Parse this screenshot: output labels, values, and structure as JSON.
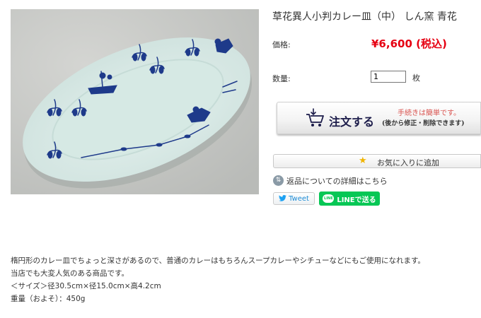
{
  "product": {
    "title": "草花異人小判カレー皿（中） しん窯 青花",
    "price_label": "価格:",
    "price_value": "¥6,600 (税込)",
    "quantity_label": "数量:",
    "quantity_value": "1",
    "quantity_unit": "枚"
  },
  "cart_button": {
    "main": "注文する",
    "note": "手続きは簡単です。",
    "sub": "(後から修正・削除できます)"
  },
  "favorite_button": {
    "label": "お気に入りに追加"
  },
  "returns_link": {
    "label": "返品についての詳細はこちら"
  },
  "share": {
    "tweet_label": "Tweet",
    "line_label": "LINEで送る",
    "line_icon_text": "LINE"
  },
  "description": {
    "line1": "楕円形のカレー皿でちょっと深さがあるので、普通のカレーはもちろんスープカレーやシチューなどにもご使用になれます。",
    "line2": "当店でも大変人気のある商品です。",
    "line3": "＜サイズ＞径30.5cm×径15.0cm×高4.2cm",
    "line4": "重量（およそ）：450g"
  },
  "colors": {
    "price": "#e60012",
    "line_green": "#06c755",
    "twitter_blue": "#1da1f2",
    "plate_glaze": "#dfeeea",
    "cobalt": "#1e3a8a"
  },
  "icons": {
    "cart": "shopping-cart-icon",
    "star": "star-icon",
    "returns": "return-arrows-icon",
    "twitter": "twitter-bird-icon",
    "line": "line-logo-icon"
  }
}
